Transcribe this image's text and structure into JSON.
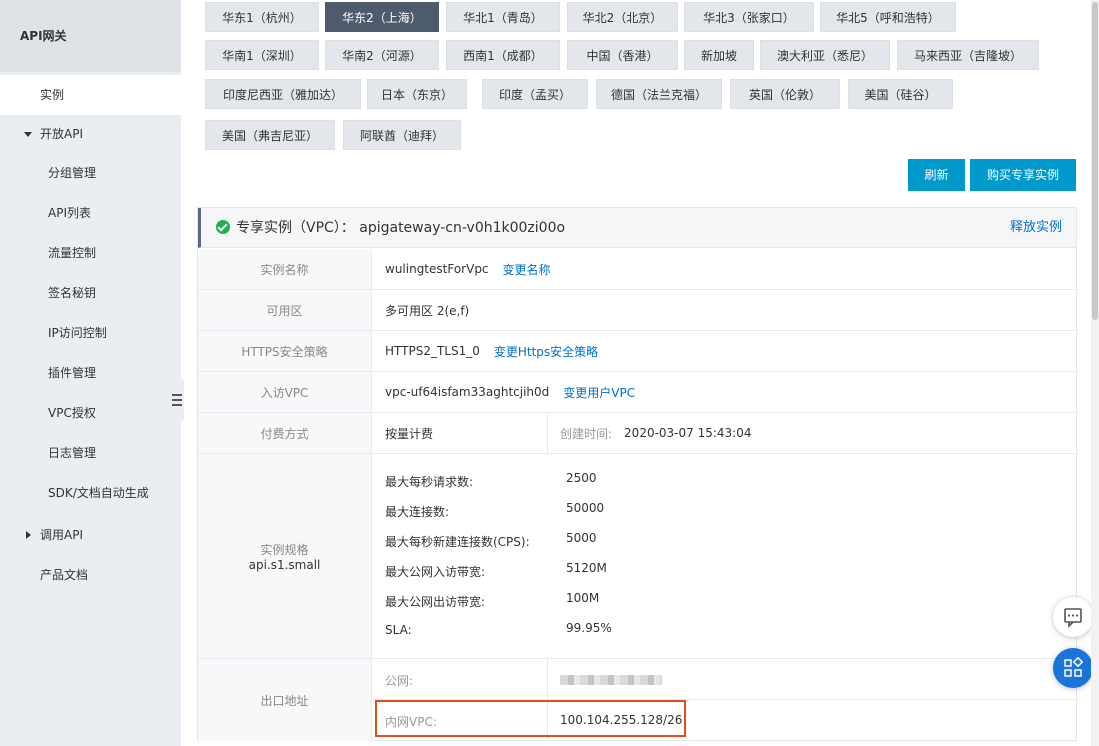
{
  "sidebar": {
    "brand": "API网关",
    "items": [
      {
        "label": "实例"
      },
      {
        "label": "开放API"
      },
      {
        "label": "分组管理"
      },
      {
        "label": "API列表"
      },
      {
        "label": "流量控制"
      },
      {
        "label": "签名秘钥"
      },
      {
        "label": "IP访问控制"
      },
      {
        "label": "插件管理"
      },
      {
        "label": "VPC授权"
      },
      {
        "label": "日志管理"
      },
      {
        "label": "SDK/文档自动生成"
      },
      {
        "label": "调用API"
      },
      {
        "label": "产品文档"
      }
    ]
  },
  "regions": [
    "华东1（杭州）",
    "华东2（上海）",
    "华北1（青岛）",
    "华北2（北京）",
    "华北3（张家口）",
    "华北5（呼和浩特）",
    "华南1（深圳）",
    "华南2（河源）",
    "西南1（成都）",
    "中国（香港）",
    "新加坡",
    "澳大利亚（悉尼）",
    "马来西亚（吉隆坡）",
    "印度尼西亚（雅加达）",
    "日本（东京）",
    "印度（孟买）",
    "德国（法兰克福）",
    "英国（伦敦）",
    "美国（硅谷）",
    "美国（弗吉尼亚）",
    "阿联酋（迪拜）"
  ],
  "toolbar": {
    "refresh_label": "刷新",
    "buy_label": "购买专享实例"
  },
  "instance": {
    "header_title": "专享实例（VPC）：  apigateway-cn-v0h1k00zi00o",
    "release_label": "释放实例",
    "rows": {
      "name_label": "实例名称",
      "name_value": "wulingtestForVpc",
      "name_action": "变更名称",
      "zone_label": "可用区",
      "zone_value": "多可用区 2(e,f)",
      "https_label": "HTTPS安全策略",
      "https_value": "HTTPS2_TLS1_0",
      "https_action": "变更Https安全策略",
      "vpc_label": "入访VPC",
      "vpc_value": "vpc-uf64isfam33aghtcjih0d",
      "vpc_action": "变更用户VPC",
      "billing_label": "付费方式",
      "billing_value": "按量计费",
      "created_label": "创建时间:",
      "created_value": "2020-03-07 15:43:04",
      "spec_label": "实例规格",
      "spec_value": "api.s1.small",
      "egress_label": "出口地址",
      "public_label": "公网:",
      "private_label": "内网VPC:",
      "private_value": "100.104.255.128/26"
    },
    "specs": [
      {
        "name": "最大每秒请求数:",
        "value": "2500"
      },
      {
        "name": "最大连接数:",
        "value": "50000"
      },
      {
        "name": "最大每秒新建连接数(CPS):",
        "value": "5000"
      },
      {
        "name": "最大公网入访带宽:",
        "value": "5120M"
      },
      {
        "name": "最大公网出访带宽:",
        "value": "100M"
      },
      {
        "name": "SLA:",
        "value": "99.95%"
      }
    ]
  },
  "colors": {
    "accent": "#0099cc",
    "link": "#0070cc",
    "highlight": "#e0501f",
    "active_region": "#4e5b6d"
  }
}
